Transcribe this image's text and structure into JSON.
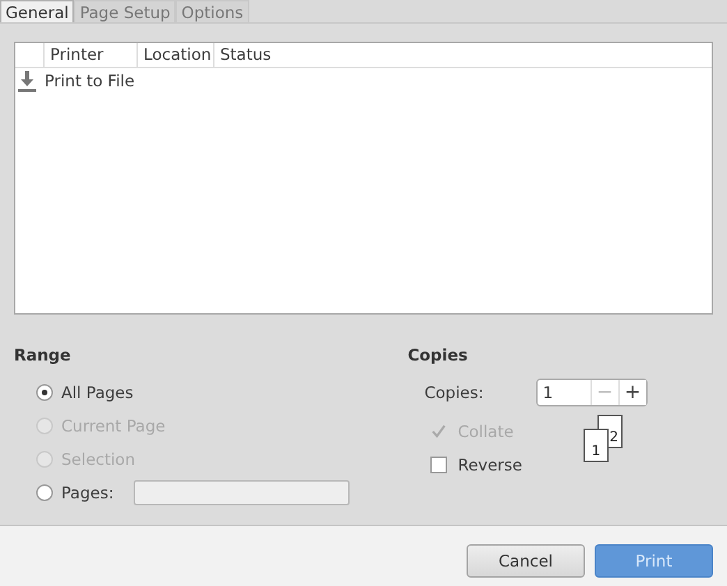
{
  "tabs": [
    {
      "label": "General",
      "selected": true
    },
    {
      "label": "Page Setup",
      "selected": false
    },
    {
      "label": "Options",
      "selected": false
    }
  ],
  "printers": {
    "columns": [
      "Printer",
      "Location",
      "Status"
    ],
    "rows": [
      {
        "name": "Print to File",
        "location": "",
        "status": ""
      }
    ]
  },
  "range": {
    "title": "Range",
    "options": [
      {
        "label": "All Pages",
        "selected": true,
        "disabled": false
      },
      {
        "label": "Current Page",
        "selected": false,
        "disabled": true
      },
      {
        "label": "Selection",
        "selected": false,
        "disabled": true
      },
      {
        "label": "Pages:",
        "selected": false,
        "disabled": false,
        "kind": "entry"
      }
    ]
  },
  "copies": {
    "title": "Copies",
    "label": "Copies:",
    "value": "1",
    "minus": "−",
    "plus": "+",
    "minus_disabled": true,
    "collate": {
      "label": "Collate",
      "checked": true,
      "disabled": true
    },
    "reverse": {
      "label": "Reverse",
      "checked": false,
      "disabled": false
    },
    "pages_icon": [
      "1",
      "2"
    ]
  },
  "buttons": [
    {
      "label": "Cancel",
      "kind": "normal",
      "disabled": false
    },
    {
      "label": "Print",
      "kind": "default",
      "disabled": true
    }
  ]
}
